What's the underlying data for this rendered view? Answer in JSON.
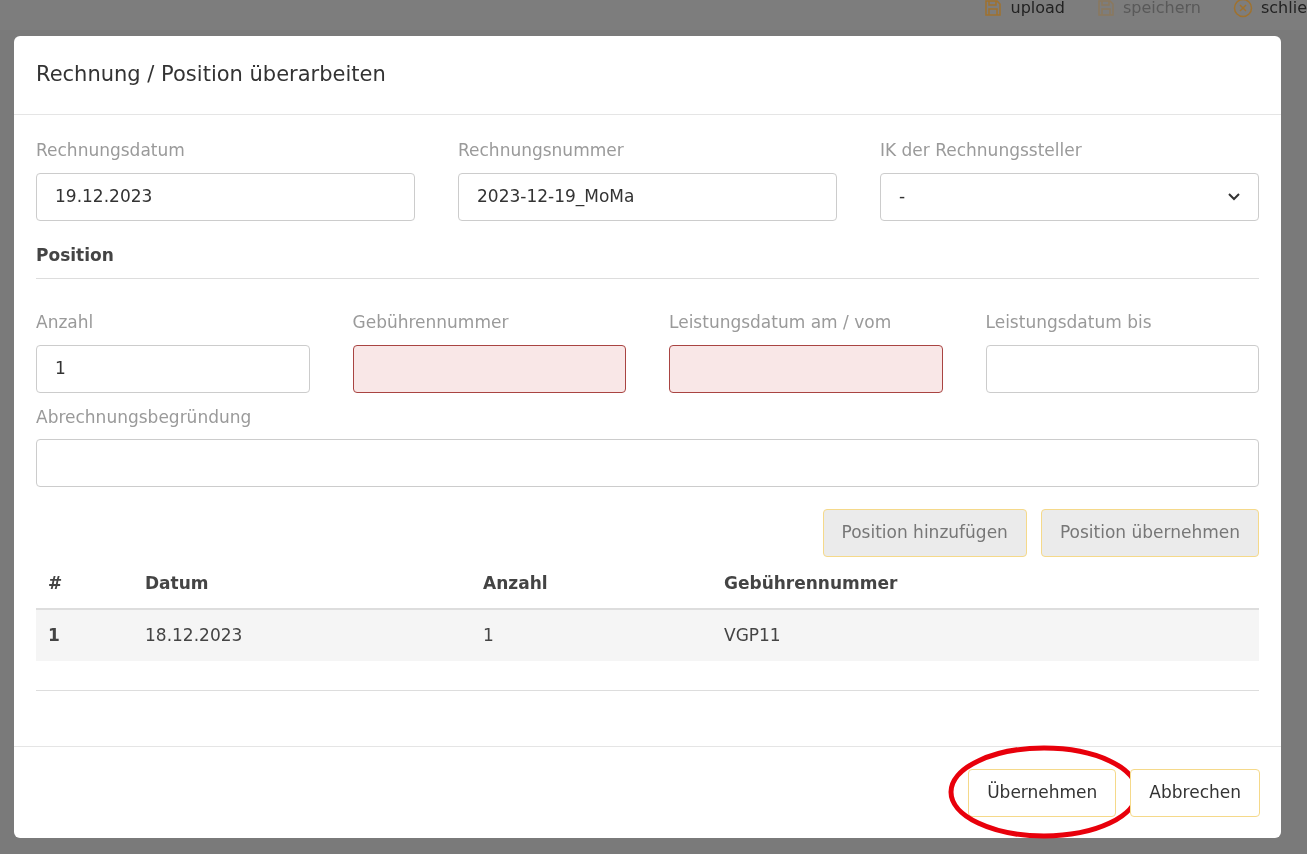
{
  "background_toolbar": [
    {
      "kind": "save",
      "label": "upload",
      "disabled": false
    },
    {
      "kind": "save",
      "label": "speichern",
      "disabled": true
    },
    {
      "kind": "close",
      "label": "schlie",
      "disabled": false
    }
  ],
  "dialog": {
    "title": "Rechnung / Position überarbeiten",
    "invoice_fields": [
      {
        "kind": "text",
        "label": "Rechnungsdatum",
        "value": "19.12.2023"
      },
      {
        "kind": "text",
        "label": "Rechnungsnummer",
        "value": "2023-12-19_MoMa"
      },
      {
        "kind": "select",
        "label": "IK der Rechnungssteller",
        "value": "-"
      }
    ],
    "section_title": "Position",
    "position_fields": [
      {
        "label": "Anzahl",
        "value": "1",
        "invalid": false
      },
      {
        "label": "Gebührennummer",
        "invalid": true
      },
      {
        "label": "Leistungsdatum am / vom",
        "invalid": true
      },
      {
        "label": "Leistungsdatum bis",
        "invalid": false
      }
    ],
    "reason_field": {
      "label": "Abrechnungsbegründung"
    },
    "position_buttons": [
      {
        "label": "Position hinzufügen",
        "disabled": true
      },
      {
        "label": "Position übernehmen",
        "disabled": true
      }
    ],
    "table": {
      "columns": [
        "#",
        "Datum",
        "Anzahl",
        "Gebührennummer"
      ],
      "rows": [
        {
          "cells": [
            "1",
            "18.12.2023",
            "1",
            "VGP11"
          ]
        }
      ]
    },
    "footer_buttons": [
      {
        "label": "Übernehmen",
        "highlighted": true
      },
      {
        "label": "Abbrechen",
        "highlighted": false
      }
    ]
  }
}
